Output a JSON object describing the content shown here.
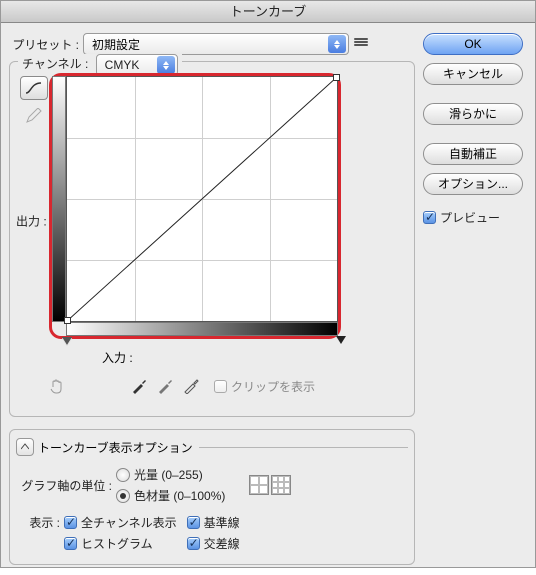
{
  "title": "トーンカーブ",
  "preset": {
    "label": "プリセット :",
    "value": "初期設定"
  },
  "channel": {
    "label": "チャンネル :",
    "value": "CMYK"
  },
  "output_label": "出力 :",
  "input_label": "入力 :",
  "clip_label": "クリップを表示",
  "options_title": "トーンカーブ表示オプション",
  "axis_label": "グラフ軸の単位 :",
  "axis_options": {
    "light": "光量 (0–255)",
    "pigment": "色材量 (0–100%)"
  },
  "axis_selected": "pigment",
  "show_label": "表示 :",
  "show_options": {
    "all_channels": "全チャンネル表示",
    "histogram": "ヒストグラム",
    "baseline": "基準線",
    "intersection": "交差線"
  },
  "buttons": {
    "ok": "OK",
    "cancel": "キャンセル",
    "smooth": "滑らかに",
    "auto": "自動補正",
    "options": "オプション..."
  },
  "preview_label": "プレビュー",
  "chart_data": {
    "type": "line",
    "title": "トーンカーブ",
    "xlabel": "入力",
    "ylabel": "出力",
    "xlim": [
      0,
      100
    ],
    "ylim": [
      0,
      100
    ],
    "series": [
      {
        "name": "CMYK",
        "x": [
          0,
          100
        ],
        "y": [
          0,
          100
        ]
      }
    ],
    "grid": true
  }
}
